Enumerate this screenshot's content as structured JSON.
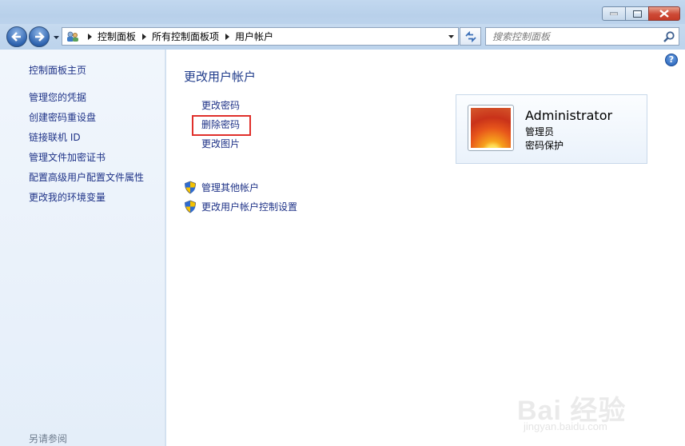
{
  "window": {
    "minimize_icon": "minimize-icon",
    "maximize_icon": "maximize-icon",
    "close_icon": "close-icon"
  },
  "address_bar": {
    "breadcrumbs": [
      "控制面板",
      "所有控制面板项",
      "用户帐户"
    ]
  },
  "search": {
    "placeholder": "搜索控制面板"
  },
  "sidebar": {
    "home": "控制面板主页",
    "items": [
      "管理您的凭据",
      "创建密码重设盘",
      "链接联机 ID",
      "管理文件加密证书",
      "配置高级用户配置文件属性",
      "更改我的环境变量"
    ],
    "see_also": "另请参阅"
  },
  "main": {
    "heading": "更改用户帐户",
    "tasks": [
      "更改密码",
      "删除密码",
      "更改图片"
    ],
    "shield_links": [
      "管理其他帐户",
      "更改用户帐户控制设置"
    ],
    "help_label": "?"
  },
  "account": {
    "name": "Administrator",
    "role": "管理员",
    "status": "密码保护"
  },
  "watermark": {
    "text": "Bai 经验",
    "sub": "jingyan.baidu.com"
  },
  "colors": {
    "link": "#1e3287",
    "highlight_border": "#e0302b",
    "heading": "#1e3a8a"
  }
}
